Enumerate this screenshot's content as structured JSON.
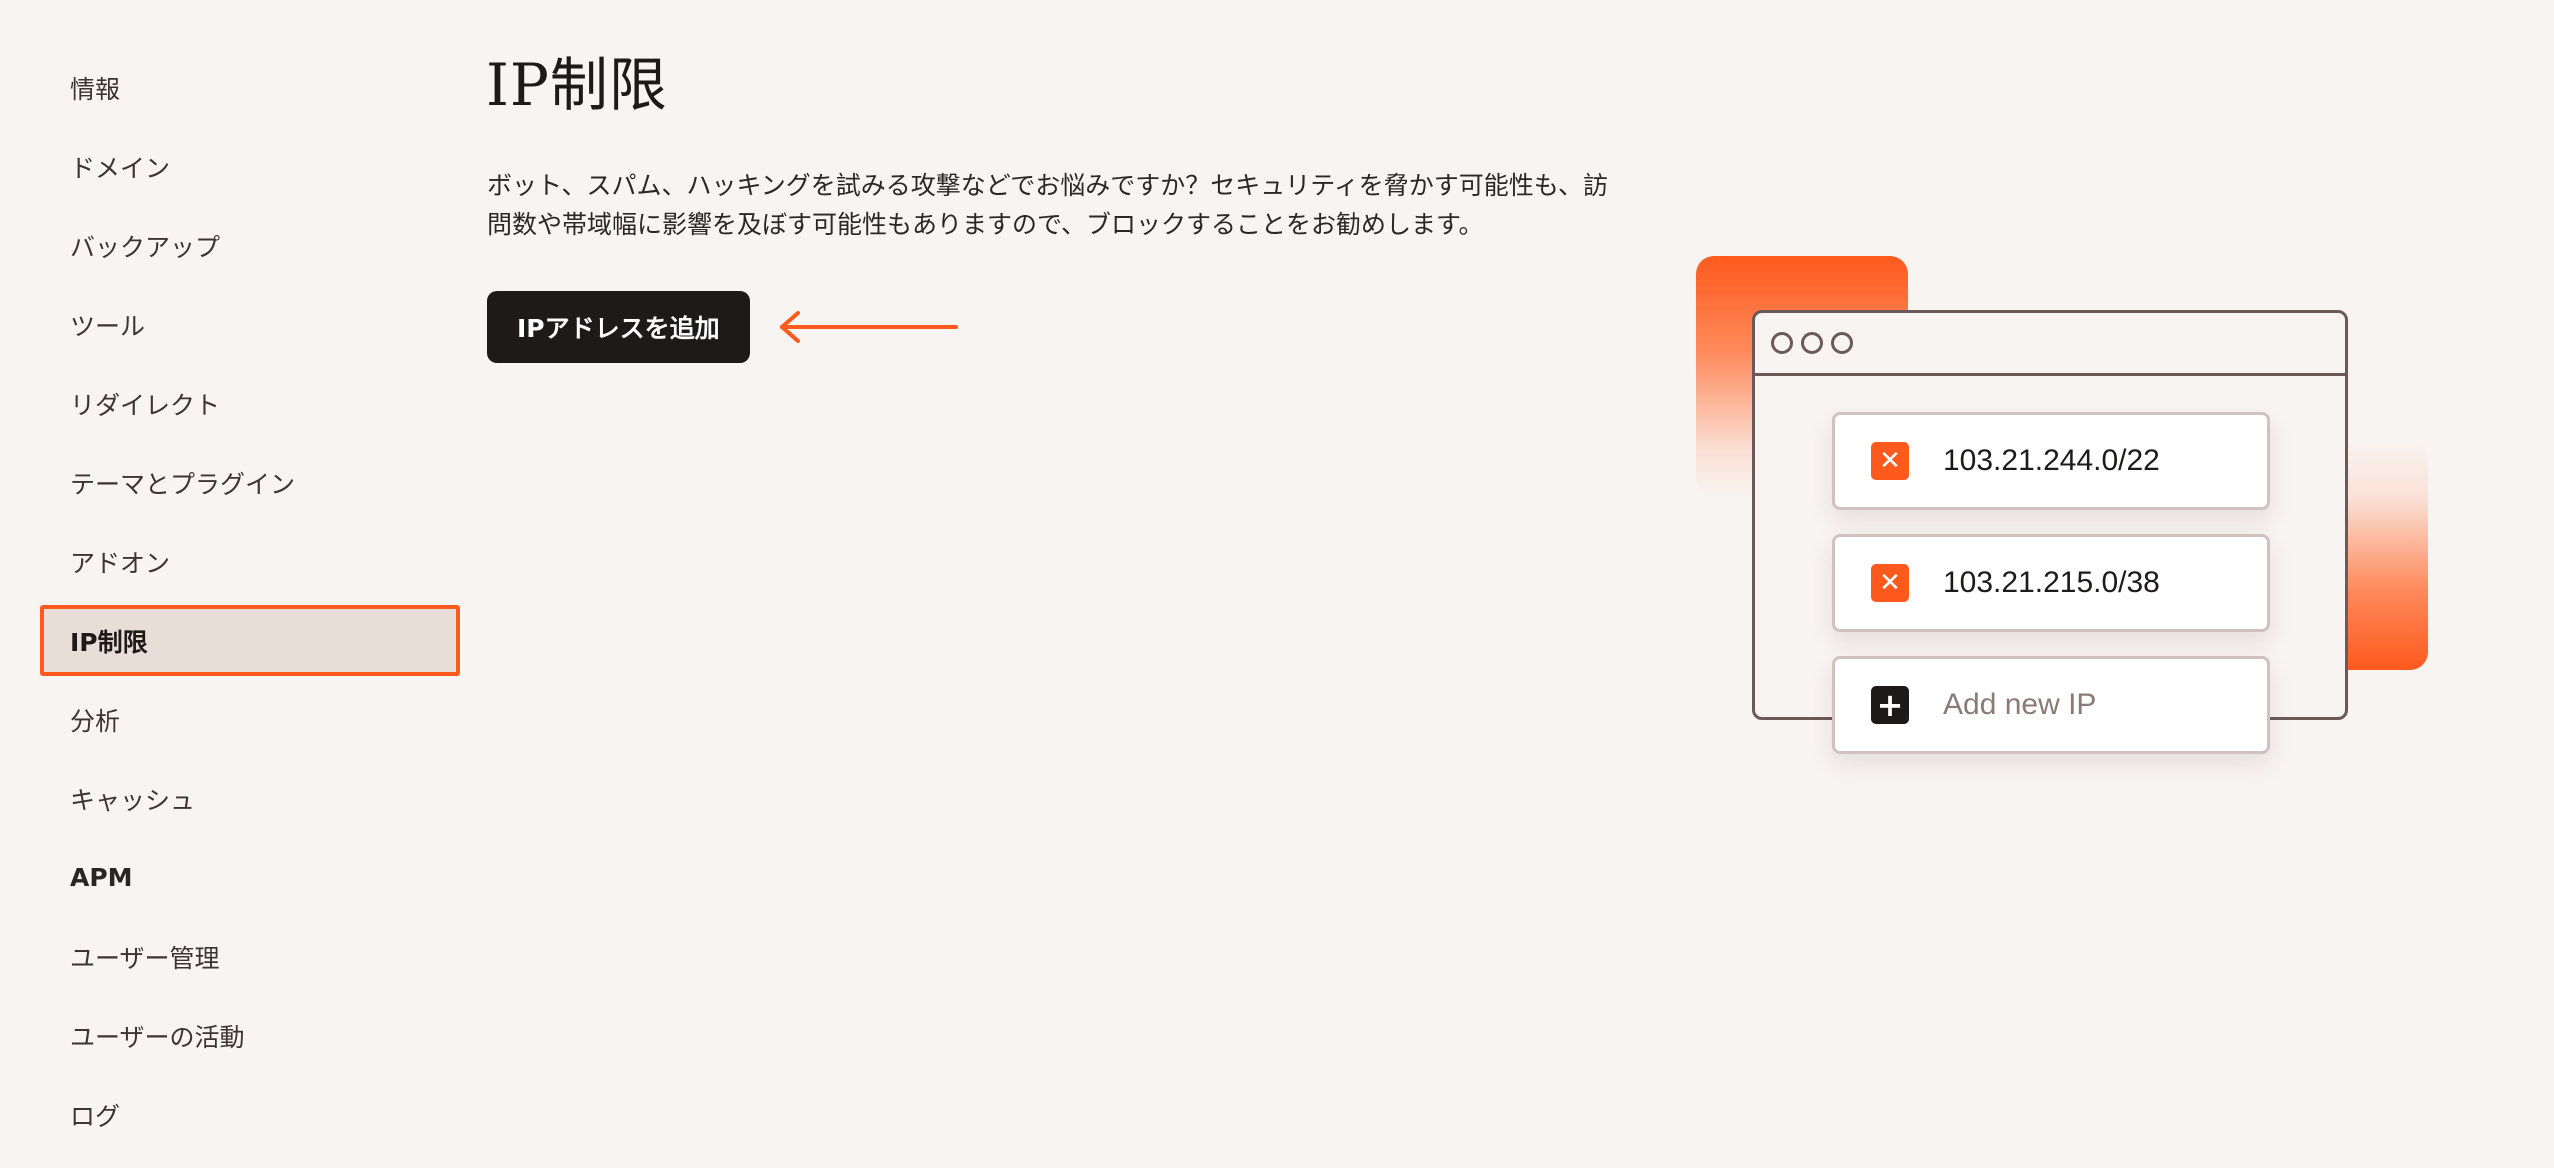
{
  "sidebar": {
    "items": [
      {
        "label": "情報"
      },
      {
        "label": "ドメイン"
      },
      {
        "label": "バックアップ"
      },
      {
        "label": "ツール"
      },
      {
        "label": "リダイレクト"
      },
      {
        "label": "テーマとプラグイン"
      },
      {
        "label": "アドオン"
      },
      {
        "label": "IP制限"
      },
      {
        "label": "分析"
      },
      {
        "label": "キャッシュ"
      },
      {
        "label": "APM"
      },
      {
        "label": "ユーザー管理"
      },
      {
        "label": "ユーザーの活動"
      },
      {
        "label": "ログ"
      }
    ],
    "active_item": "IP制限"
  },
  "main": {
    "title": "IP制限",
    "description_line1": "ボット、スパム、ハッキングを試みる攻撃などでお悩みですか？セキュリティを脅かす可能性も、訪",
    "description_line2": "問数や帯域幅に影響を及ぼす可能性もありますので、ブロックすることをお勧めします。",
    "add_button_label": "IPアドレスを追加"
  },
  "illustration": {
    "ip_entries": [
      {
        "ip": "103.21.244.0/22",
        "icon": "close-icon"
      },
      {
        "ip": "103.21.215.0/38",
        "icon": "close-icon"
      }
    ],
    "add_new_label": "Add new IP",
    "add_icon": "plus-icon"
  },
  "colors": {
    "accent": "#fe5a1d",
    "dark": "#1d1a19",
    "background": "#f8f4f2",
    "active_bg": "#e9ddd8"
  }
}
